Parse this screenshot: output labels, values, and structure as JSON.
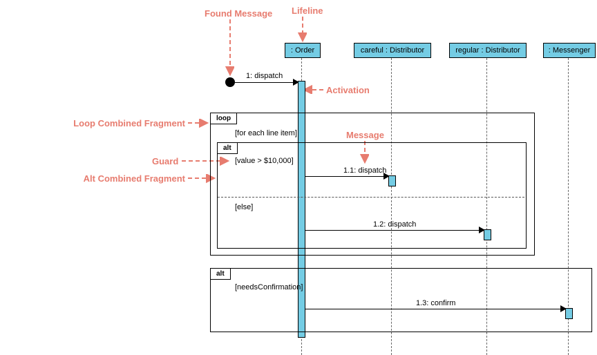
{
  "annotations": {
    "found_message": "Found Message",
    "lifeline": "Lifeline",
    "activation": "Activation",
    "loop_combined_fragment": "Loop Combined Fragment",
    "message": "Message",
    "guard": "Guard",
    "alt_combined_fragment": "Alt Combined Fragment"
  },
  "lifelines": {
    "order": ": Order",
    "careful": "careful : Distributor",
    "regular": "regular : Distributor",
    "messenger": ": Messenger"
  },
  "messages": {
    "m1": "1: dispatch",
    "m1_1": "1.1: dispatch",
    "m1_2": "1.2: dispatch",
    "m1_3": "1.3: confirm"
  },
  "fragments": {
    "loop": {
      "label": "loop",
      "guard": "[for each line item]"
    },
    "alt1": {
      "label": "alt",
      "guard1": "[value > $10,000]",
      "guard2": "[else]"
    },
    "alt2": {
      "label": "alt",
      "guard": "[needsConfirmation]"
    }
  }
}
